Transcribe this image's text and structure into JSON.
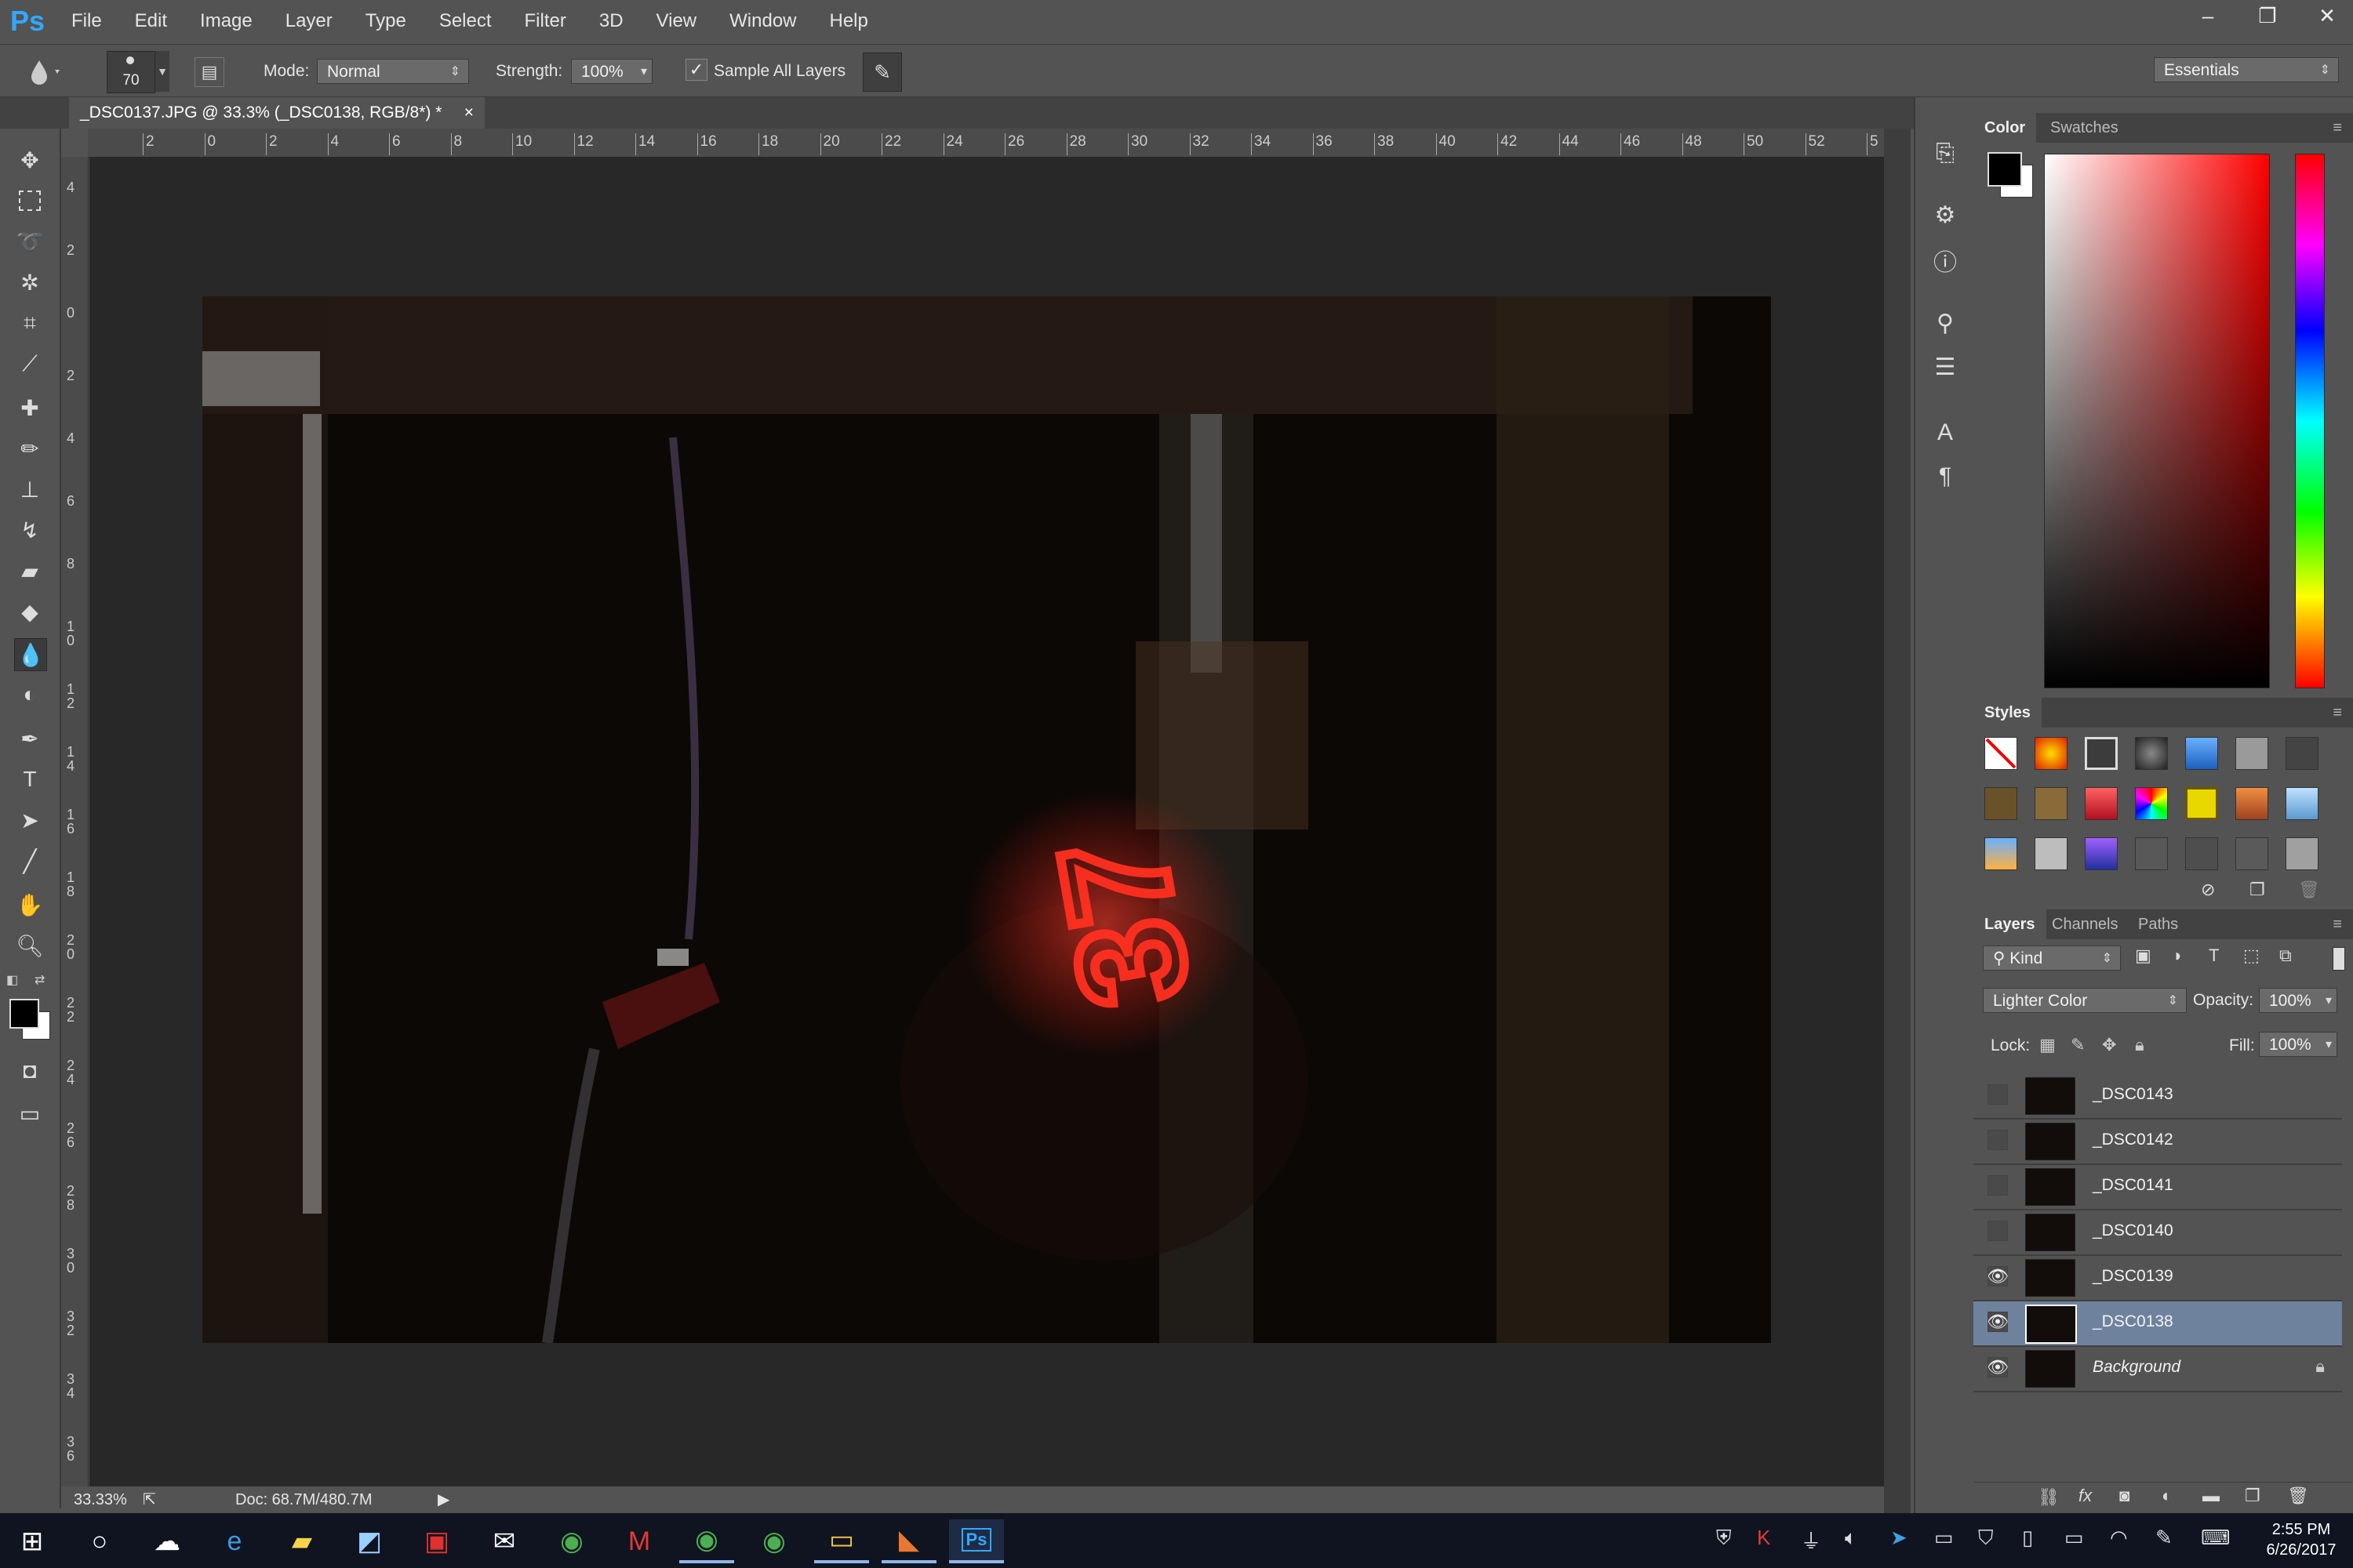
{
  "app": {
    "logo": "Ps",
    "menu": [
      "File",
      "Edit",
      "Image",
      "Layer",
      "Type",
      "Select",
      "Filter",
      "3D",
      "View",
      "Window",
      "Help"
    ],
    "window_controls": [
      "–",
      "❐",
      "✕"
    ]
  },
  "options": {
    "brush_size": "70",
    "mode_label": "Mode:",
    "mode_value": "Normal",
    "strength_label": "Strength:",
    "strength_value": "100%",
    "sample_all_label": "Sample All Layers",
    "sample_all_checked": true,
    "workspace": "Essentials"
  },
  "document": {
    "tab_title": "_DSC0137.JPG @ 33.3% (_DSC0138, RGB/8*) *",
    "tab_close": "×",
    "zoom": "33.33%",
    "doc_info": "Doc: 68.7M/480.7M"
  },
  "ruler": {
    "h_labels": [
      "2",
      "0",
      "2",
      "4",
      "6",
      "8",
      "10",
      "12",
      "14",
      "16",
      "18",
      "20",
      "22",
      "24",
      "26",
      "28",
      "30",
      "32",
      "34",
      "36",
      "38",
      "40",
      "42",
      "44",
      "46",
      "48",
      "50",
      "52",
      "5"
    ],
    "v_labels": [
      "4",
      "2",
      "0",
      "2",
      "4",
      "6",
      "8",
      "1 0",
      "1 2",
      "1 4",
      "1 6",
      "1 8",
      "2 0",
      "2 2",
      "2 4",
      "2 6",
      "2 8",
      "3 0",
      "3 2",
      "3 4",
      "3 6",
      "3"
    ]
  },
  "panels": {
    "color_tabs": [
      "Color",
      "Swatches"
    ],
    "styles_title": "Styles",
    "layers_tabs": [
      "Layers",
      "Channels",
      "Paths"
    ],
    "kind_label": "Kind",
    "blend_mode": "Lighter Color",
    "opacity_label": "Opacity:",
    "opacity_value": "100%",
    "lock_label": "Lock:",
    "fill_label": "Fill:",
    "fill_value": "100%",
    "layers": [
      {
        "name": "_DSC0143",
        "visible": false,
        "selected": false
      },
      {
        "name": "_DSC0142",
        "visible": false,
        "selected": false
      },
      {
        "name": "_DSC0141",
        "visible": false,
        "selected": false
      },
      {
        "name": "_DSC0140",
        "visible": false,
        "selected": false
      },
      {
        "name": "_DSC0139",
        "visible": true,
        "selected": false
      },
      {
        "name": "_DSC0138",
        "visible": true,
        "selected": true
      },
      {
        "name": "Background",
        "visible": true,
        "selected": false,
        "locked": true
      }
    ]
  },
  "taskbar": {
    "time": "2:55 PM",
    "date": "6/26/2017"
  },
  "colors": {
    "ps_blue": "#31a8ff",
    "selected_layer": "#6e829e",
    "taskbar": "#0f1420",
    "glow_red": "#ff2a1a"
  }
}
